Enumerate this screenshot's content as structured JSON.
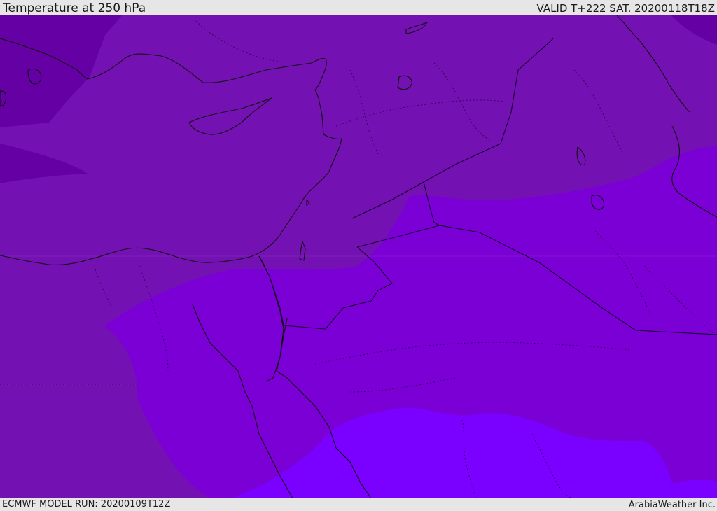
{
  "header": {
    "title": "Temperature at 250 hPa",
    "valid": "VALID T+222 SAT. 20200118T18Z"
  },
  "footer": {
    "model_run": "ECMWF MODEL RUN: 20200109T12Z",
    "credit": "ArabiaWeather Inc."
  },
  "map": {
    "colors": {
      "band_darkest": "#6500a4",
      "band_dark": "#7411b2",
      "band_mid": "#7a00d6",
      "band_bright": "#7a00ff",
      "coastline": "#111111",
      "border": "#2a0040"
    }
  }
}
